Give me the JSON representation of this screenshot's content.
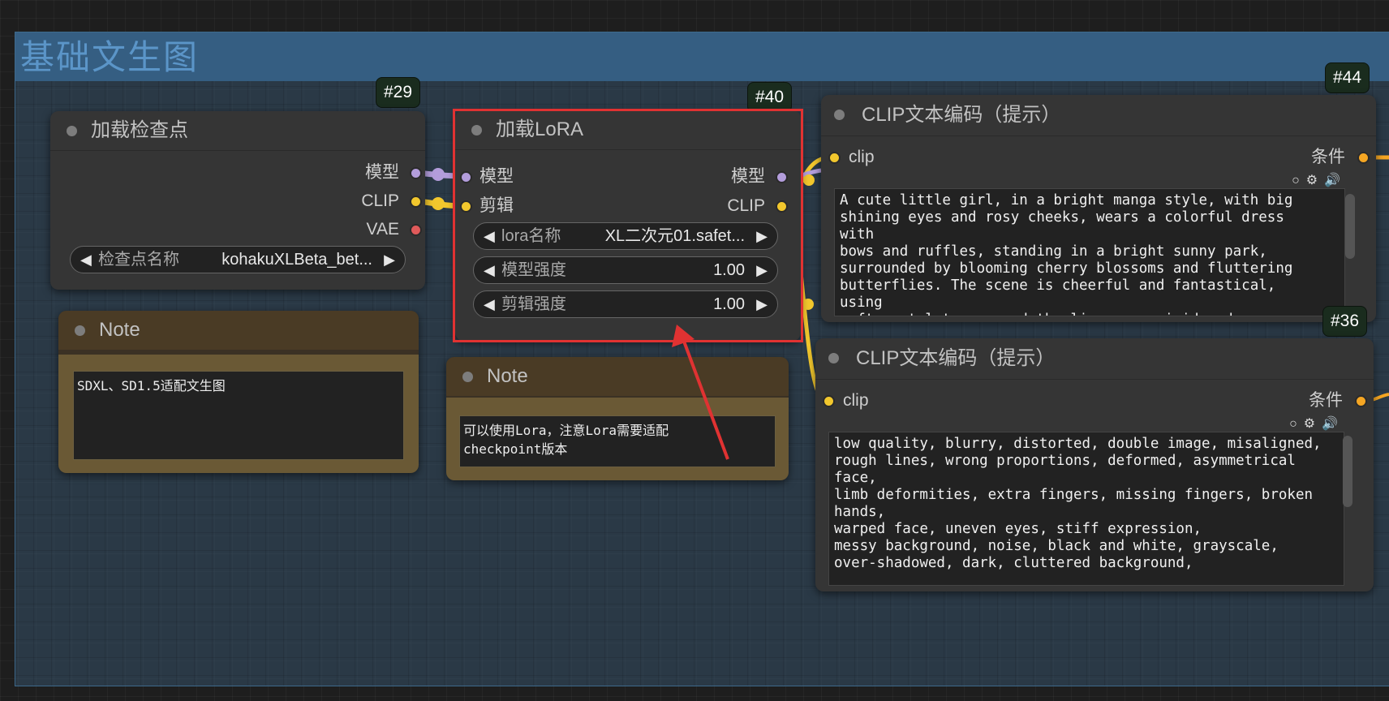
{
  "group": {
    "title": "基础文生图"
  },
  "nodes": {
    "checkpoint": {
      "badge": "#29",
      "title": "加载检查点",
      "outputs": [
        "模型",
        "CLIP",
        "VAE"
      ],
      "widget": {
        "label": "检查点名称",
        "value": "kohakuXLBeta_bet..."
      }
    },
    "lora": {
      "badge": "#40",
      "title": "加载LoRA",
      "inputs": [
        "模型",
        "剪辑"
      ],
      "outputs": [
        "模型",
        "CLIP"
      ],
      "widgets": [
        {
          "label": "lora名称",
          "value": "XL二次元01.safet..."
        },
        {
          "label": "模型强度",
          "value": "1.00"
        },
        {
          "label": "剪辑强度",
          "value": "1.00"
        }
      ]
    },
    "clip_positive": {
      "badge": "#44",
      "title": "CLIP文本编码（提示）",
      "input": "clip",
      "output": "条件",
      "text": "A cute little girl, in a bright manga style, with big\nshining eyes and rosy cheeks, wears a colorful dress with\nbows and ruffles, standing in a bright sunny park,\nsurrounded by blooming cherry blossoms and fluttering\nbutterflies. The scene is cheerful and fantastical, using\nsoft pastel tones, and the lines are vivid and expressive,\nwith charming cartoon details. With a clear blue sky and"
    },
    "clip_negative": {
      "badge": "#36",
      "title": "CLIP文本编码（提示）",
      "input": "clip",
      "output": "条件",
      "text": "low quality, blurry, distorted, double image, misaligned,\nrough lines, wrong proportions, deformed, asymmetrical\nface,\nlimb deformities, extra fingers, missing fingers, broken\nhands,\nwarped face, uneven eyes, stiff expression,\nmessy background, noise, black and white, grayscale,\nover-shadowed, dark, cluttered background,"
    },
    "note1": {
      "title": "Note",
      "text": "SDXL、SD1.5适配文生图"
    },
    "note2": {
      "title": "Note",
      "text": "可以使用Lora，注意Lora需要适配\ncheckpoint版本"
    }
  },
  "icons": {
    "arrow_left": "◀",
    "arrow_right": "▶",
    "toggle": "○",
    "gear": "⚙",
    "speaker": "🔊"
  },
  "colors": {
    "model_socket": "#b39ddb",
    "clip_socket": "#f2c72d",
    "vae_socket": "#e05a5a",
    "conditioning_socket": "#f5a623",
    "highlight": "#e03232",
    "group_bg": "#345068"
  }
}
